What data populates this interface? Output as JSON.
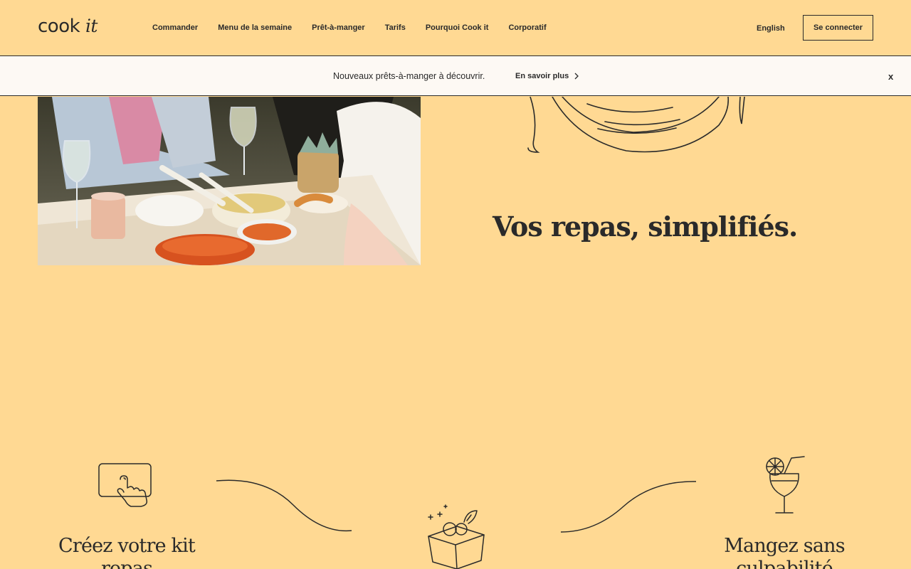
{
  "header": {
    "logo": {
      "word1": "cook",
      "word2": "it"
    },
    "nav": [
      "Commander",
      "Menu de la semaine",
      "Prêt-à-manger",
      "Tarifs",
      "Pourquoi Cook it",
      "Corporatif"
    ],
    "language": "English",
    "login_label": "Se connecter"
  },
  "banner": {
    "text": "Nouveaux prêts-à-manger à découvrir.",
    "link": "En savoir plus",
    "close": "x"
  },
  "hero": {
    "title": "Vos repas, simplifiés."
  },
  "steps": [
    {
      "title": "Créez votre kit repas",
      "icon": "touch-screen-icon"
    },
    {
      "title": "",
      "icon": "grocery-box-icon"
    },
    {
      "title": "Mangez sans culpabilité",
      "icon": "cocktail-glass-icon"
    }
  ],
  "colors": {
    "background": "#FFD993",
    "banner": "#FDF9F4",
    "text": "#2a2a2a"
  }
}
